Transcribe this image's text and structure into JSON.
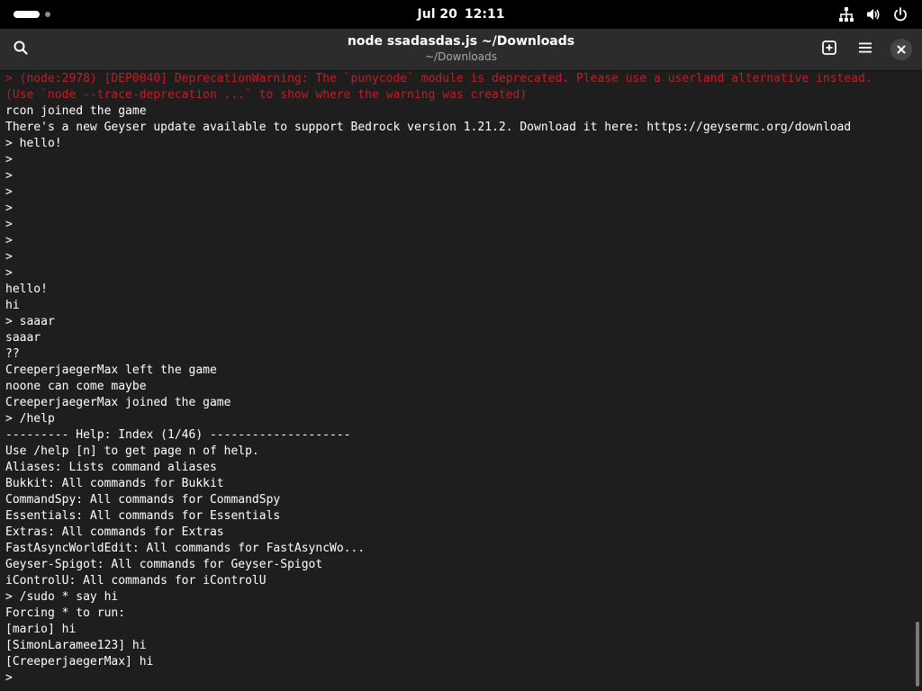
{
  "topbar": {
    "date": "Jul 20",
    "time": "12:11",
    "icons": [
      "network-icon",
      "volume-icon",
      "power-icon"
    ]
  },
  "window": {
    "title": "node ssadasdas.js ~/Downloads",
    "subtitle": "~/Downloads",
    "buttons": [
      "search-icon",
      "new-tab-icon",
      "menu-icon",
      "close-icon"
    ]
  },
  "colors": {
    "error_text": "#c01c28",
    "terminal_bg": "#1e1e1e",
    "terminal_fg": "#ffffff"
  },
  "terminal": {
    "lines": [
      {
        "text": "> (node:2978) [DEP0040] DeprecationWarning: The `punycode` module is deprecated. Please use a userland alternative instead.",
        "error": true
      },
      {
        "text": "(Use `node --trace-deprecation ...` to show where the warning was created)",
        "error": true
      },
      {
        "text": "rcon joined the game",
        "error": false
      },
      {
        "text": "There's a new Geyser update available to support Bedrock version 1.21.2. Download it here: https://geysermc.org/download",
        "error": false
      },
      {
        "text": "> hello!",
        "error": false
      },
      {
        "text": ">",
        "error": false
      },
      {
        "text": ">",
        "error": false
      },
      {
        "text": ">",
        "error": false
      },
      {
        "text": ">",
        "error": false
      },
      {
        "text": ">",
        "error": false
      },
      {
        "text": ">",
        "error": false
      },
      {
        "text": ">",
        "error": false
      },
      {
        "text": ">",
        "error": false
      },
      {
        "text": "hello!",
        "error": false
      },
      {
        "text": "hi",
        "error": false
      },
      {
        "text": "> saaar",
        "error": false
      },
      {
        "text": "saaar",
        "error": false
      },
      {
        "text": "??",
        "error": false
      },
      {
        "text": "CreeperjaegerMax left the game",
        "error": false
      },
      {
        "text": "noone can come maybe",
        "error": false
      },
      {
        "text": "CreeperjaegerMax joined the game",
        "error": false
      },
      {
        "text": "> /help",
        "error": false
      },
      {
        "text": "--------- Help: Index (1/46) --------------------",
        "error": false
      },
      {
        "text": "Use /help [n] to get page n of help.",
        "error": false
      },
      {
        "text": "Aliases: Lists command aliases",
        "error": false
      },
      {
        "text": "Bukkit: All commands for Bukkit",
        "error": false
      },
      {
        "text": "CommandSpy: All commands for CommandSpy",
        "error": false
      },
      {
        "text": "Essentials: All commands for Essentials",
        "error": false
      },
      {
        "text": "Extras: All commands for Extras",
        "error": false
      },
      {
        "text": "FastAsyncWorldEdit: All commands for FastAsyncWo...",
        "error": false
      },
      {
        "text": "Geyser-Spigot: All commands for Geyser-Spigot",
        "error": false
      },
      {
        "text": "iControlU: All commands for iControlU",
        "error": false
      },
      {
        "text": "> /sudo * say hi",
        "error": false
      },
      {
        "text": "Forcing * to run:",
        "error": false
      },
      {
        "text": "[mario] hi",
        "error": false
      },
      {
        "text": "[SimonLaramee123] hi",
        "error": false
      },
      {
        "text": "[CreeperjaegerMax] hi",
        "error": false
      },
      {
        "text": ">",
        "error": false
      }
    ]
  }
}
